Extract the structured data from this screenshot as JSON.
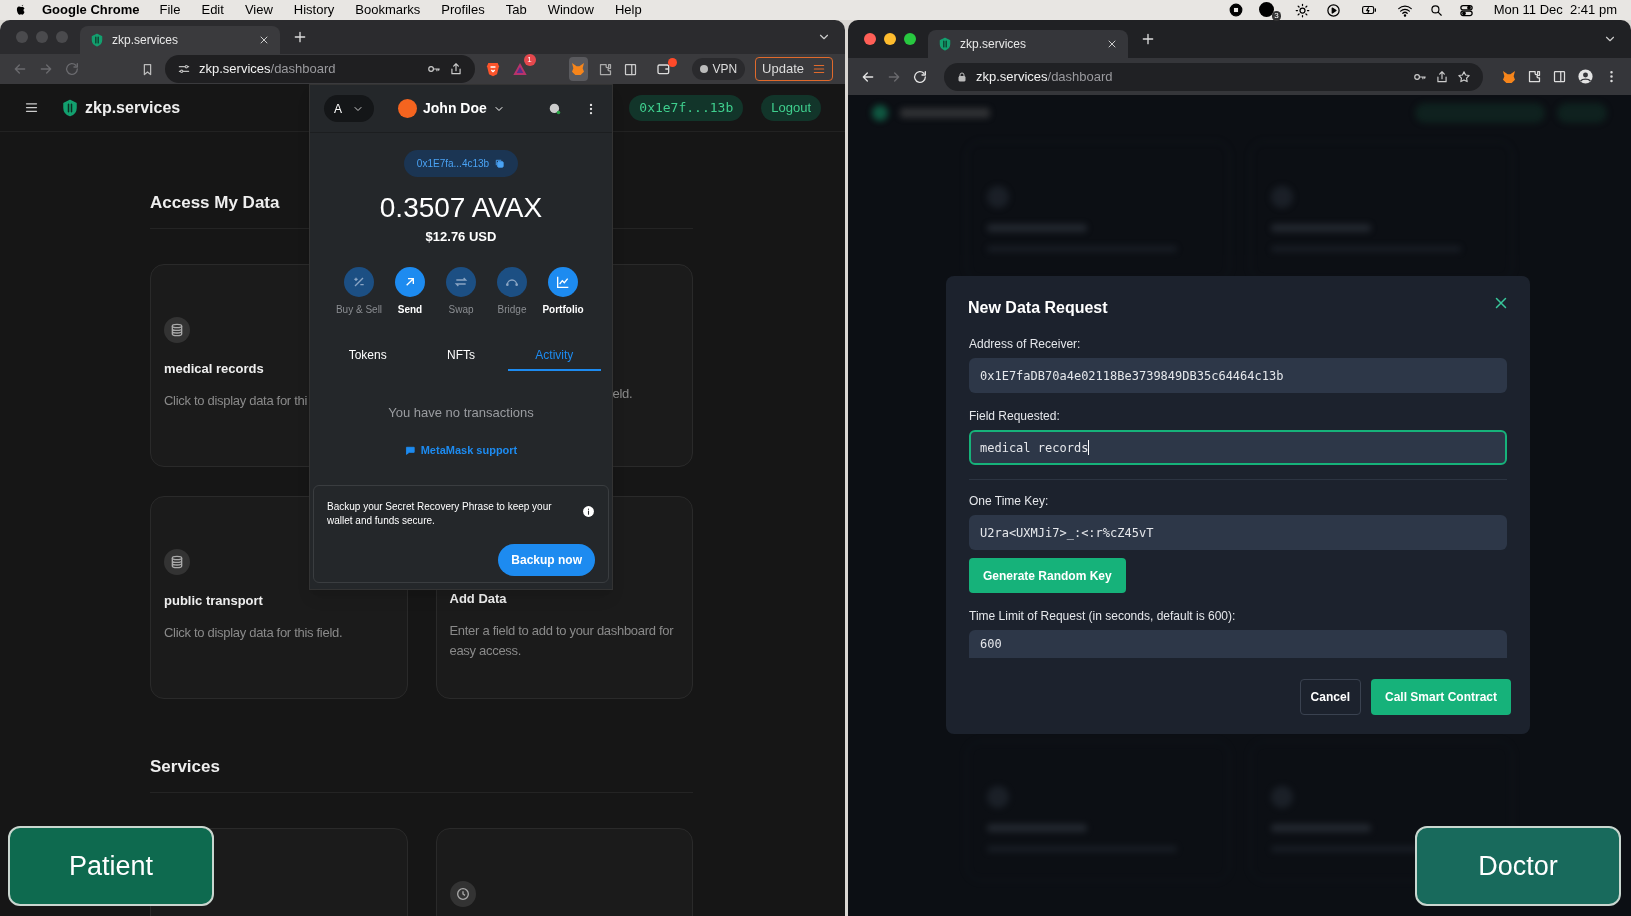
{
  "menu_bar": {
    "app": "Google Chrome",
    "items": [
      "File",
      "Edit",
      "View",
      "History",
      "Bookmarks",
      "Profiles",
      "Tab",
      "Window",
      "Help"
    ],
    "status_badge": "3",
    "clock": "Mon 11 Dec  2:41 pm"
  },
  "left_browser": {
    "tab": {
      "title": "zkp.services"
    },
    "nav": [
      {
        "kind": "back",
        "disabled": true
      },
      {
        "kind": "forward",
        "disabled": true
      },
      {
        "kind": "reload",
        "disabled": true
      }
    ],
    "address": {
      "host": "zkp.services",
      "path": "/dashboard"
    },
    "alert_badge": "1",
    "vpn": "VPN",
    "update": "Update",
    "app": {
      "brand": "zkp.services",
      "wallet": "0x1e7f...13b",
      "logout": "Logout",
      "sections": [
        {
          "title": "Access My Data",
          "cards": [
            {
              "title": "medical records",
              "description": "Click to display data for thi",
              "show_icon": true
            },
            {
              "description": "eld.",
              "show_icon": false
            },
            {
              "title": "public transport",
              "description": "Click to display data for this field.",
              "show_icon": true
            },
            {
              "title": "Add Data",
              "description": "Enter a field to add to your dashboard for easy access.",
              "show_icon": false
            }
          ]
        },
        {
          "title": "Services",
          "cards": [
            {
              "show_icon": false
            },
            {
              "show_icon": true
            }
          ]
        }
      ]
    },
    "wallet_popup": {
      "account": "A",
      "name": "John Doe",
      "address": "0x1E7fa...4c13b",
      "balance": "0.3507 AVAX",
      "fiat": "$12.76 USD",
      "actions": [
        {
          "kind": "buy",
          "label": "Buy & Sell",
          "disabled": true
        },
        {
          "kind": "send",
          "label": "Send",
          "disabled": false
        },
        {
          "kind": "swap",
          "label": "Swap",
          "disabled": true
        },
        {
          "kind": "bridge",
          "label": "Bridge",
          "disabled": true
        },
        {
          "kind": "portfolio",
          "label": "Portfolio",
          "disabled": false
        }
      ],
      "tabs": [
        {
          "label": "Tokens",
          "selected": false
        },
        {
          "label": "NFTs",
          "selected": false
        },
        {
          "label": "Activity",
          "selected": true
        }
      ],
      "empty": "You have no transactions",
      "support": "MetaMask support",
      "banner": "Backup your Secret Recovery Phrase to keep your wallet and funds secure.",
      "backup": "Backup now"
    }
  },
  "right_browser": {
    "tab": {
      "title": "zkp.services"
    },
    "nav": [
      {
        "kind": "back",
        "disabled": false
      },
      {
        "kind": "forward",
        "disabled": true
      },
      {
        "kind": "reload",
        "disabled": false
      }
    ],
    "address": {
      "host": "zkp.services",
      "path": "/dashboard"
    },
    "modal": {
      "title": "New Data Request",
      "fields": [
        {
          "label": "Address of Receiver:",
          "value": "0x1E7faDB70a4e02118Be3739849DB35c64464c13b",
          "focused": false
        },
        {
          "label": "Field Requested:",
          "value": "medical records",
          "focused": true
        },
        {
          "label": "One Time Key:",
          "value": "U2ra<UXMJi7>_:<:r%cZ45vT",
          "focused": false,
          "action": "Generate Random Key"
        },
        {
          "label": "Time Limit of Request (in seconds, default is 600):",
          "value": "600",
          "focused": false
        }
      ],
      "cancel": "Cancel",
      "submit": "Call Smart Contract"
    }
  },
  "role_labels": [
    {
      "text": "Patient"
    },
    {
      "text": "Doctor"
    }
  ]
}
